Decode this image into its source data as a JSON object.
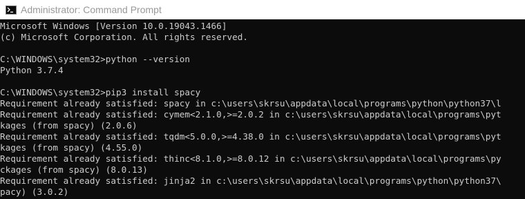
{
  "window": {
    "title": "Administrator: Command Prompt",
    "icon": "cmd-icon"
  },
  "console": {
    "lines": [
      "Microsoft Windows [Version 10.0.19043.1466]",
      "(c) Microsoft Corporation. All rights reserved.",
      "",
      "C:\\WINDOWS\\system32>python --version",
      "Python 3.7.4",
      "",
      "C:\\WINDOWS\\system32>pip3 install spacy",
      "Requirement already satisfied: spacy in c:\\users\\skrsu\\appdata\\local\\programs\\python\\python37\\l",
      "Requirement already satisfied: cymem<2.1.0,>=2.0.2 in c:\\users\\skrsu\\appdata\\local\\programs\\pyt",
      "kages (from spacy) (2.0.6)",
      "Requirement already satisfied: tqdm<5.0.0,>=4.38.0 in c:\\users\\skrsu\\appdata\\local\\programs\\pyt",
      "kages (from spacy) (4.55.0)",
      "Requirement already satisfied: thinc<8.1.0,>=8.0.12 in c:\\users\\skrsu\\appdata\\local\\programs\\py",
      "ckages (from spacy) (8.0.13)",
      "Requirement already satisfied: jinja2 in c:\\users\\skrsu\\appdata\\local\\programs\\python\\python37\\",
      "pacy) (3.0.2)"
    ]
  },
  "colors": {
    "console_background": "#0c0c0c",
    "console_text": "#cccccc",
    "titlebar_background": "#ffffff",
    "title_text": "#999999"
  }
}
